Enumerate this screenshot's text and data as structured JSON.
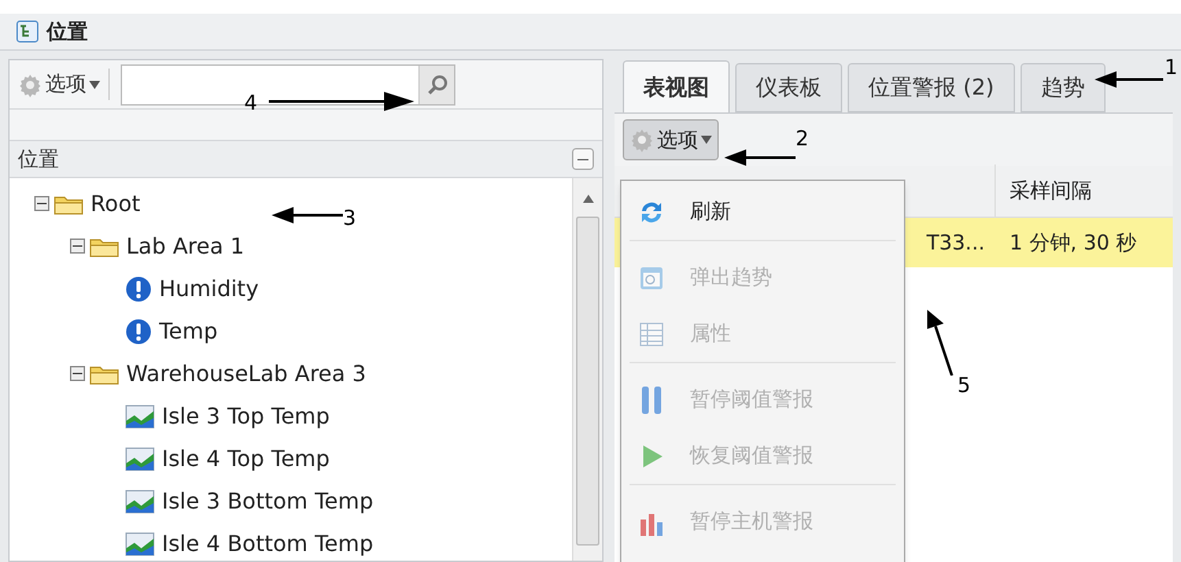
{
  "window": {
    "title": "位置"
  },
  "left_panel": {
    "options_button": "选项",
    "header": "位置",
    "tree": [
      {
        "label": "Root",
        "kind": "folder",
        "expanded": true,
        "children": [
          {
            "label": "Lab Area 1",
            "kind": "folder",
            "expanded": true,
            "children": [
              {
                "label": "Humidity",
                "kind": "alert"
              },
              {
                "label": "Temp",
                "kind": "alert"
              }
            ]
          },
          {
            "label": "WarehouseLab Area 3",
            "kind": "folder",
            "expanded": true,
            "children": [
              {
                "label": "Isle 3 Top Temp",
                "kind": "sensor"
              },
              {
                "label": "Isle 4 Top Temp",
                "kind": "sensor"
              },
              {
                "label": "Isle 3 Bottom Temp",
                "kind": "sensor"
              },
              {
                "label": "Isle 4 Bottom Temp",
                "kind": "sensor"
              }
            ]
          }
        ]
      }
    ]
  },
  "tabs": [
    {
      "label": "表视图",
      "selected": true
    },
    {
      "label": "仪表板",
      "selected": false
    },
    {
      "label": "位置警报 (2)",
      "selected": false
    },
    {
      "label": "趋势",
      "selected": false
    }
  ],
  "right_panel": {
    "options_button": "选项",
    "table": {
      "columns": [
        null,
        "采样间隔"
      ],
      "rows": [
        {
          "cells": [
            "T33...",
            "1 分钟, 30 秒"
          ],
          "selected": true
        }
      ]
    }
  },
  "menu": {
    "groups": [
      [
        {
          "label": "刷新",
          "kind": "refresh",
          "disabled": false
        }
      ],
      [
        {
          "label": "弹出趋势",
          "kind": "popup",
          "disabled": true
        },
        {
          "label": "属性",
          "kind": "table",
          "disabled": true
        }
      ],
      [
        {
          "label": "暂停阈值警报",
          "kind": "pause",
          "disabled": true
        },
        {
          "label": "恢复阈值警报",
          "kind": "play",
          "disabled": true
        }
      ],
      [
        {
          "label": "暂停主机警报",
          "kind": "bars",
          "disabled": true
        }
      ]
    ]
  },
  "callouts": [
    {
      "label": "1"
    },
    {
      "label": "2"
    },
    {
      "label": "3"
    },
    {
      "label": "4"
    },
    {
      "label": "5"
    }
  ]
}
